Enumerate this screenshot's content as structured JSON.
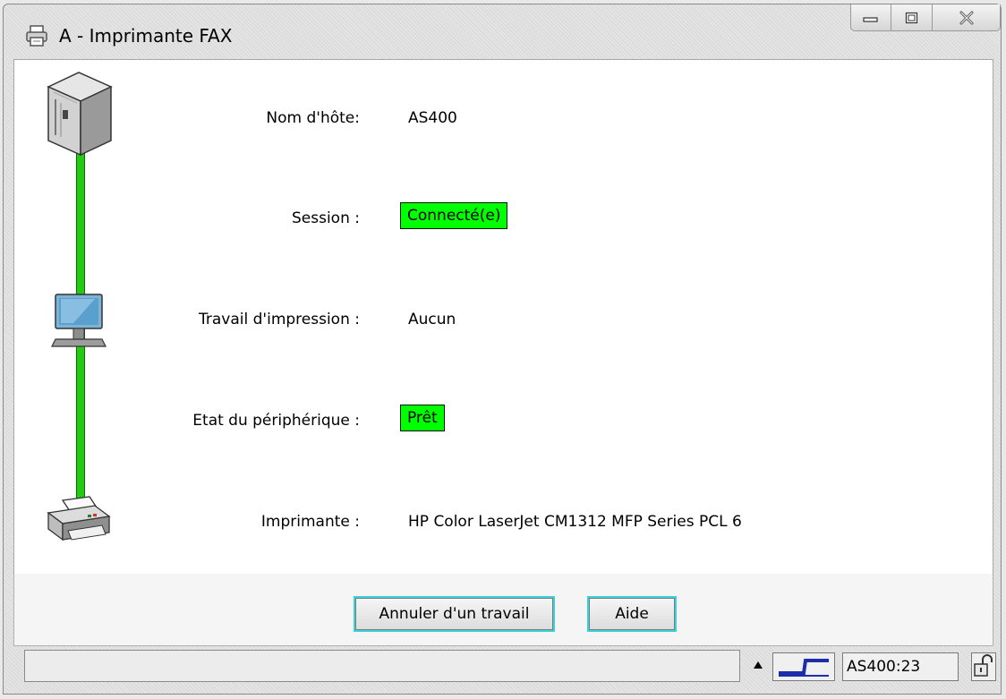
{
  "window": {
    "title": "A - Imprimante FAX",
    "title_icon": "printer-icon",
    "controls": [
      "minimize-icon",
      "maximize-icon",
      "close-icon"
    ]
  },
  "rows": {
    "host": {
      "label": "Nom d'hôte:",
      "value": "AS400"
    },
    "session": {
      "label": "Session :",
      "value": "Connecté(e)"
    },
    "job": {
      "label": "Travail d'impression :",
      "value": "Aucun"
    },
    "device": {
      "label": "Etat du périphérique :",
      "value": "Prêt"
    },
    "printer": {
      "label": "Imprimante :",
      "value": "HP Color LaserJet CM1312 MFP Series PCL 6"
    }
  },
  "chain_icons": [
    "server-icon",
    "monitor-icon",
    "printer-device-icon"
  ],
  "buttons": {
    "cancel_job": "Annuler d'un travail",
    "help": "Aide"
  },
  "statusbar": {
    "message": "",
    "host_port": "AS400:23",
    "connection_icon": "connection-icon",
    "lock_icon": "lock-icon"
  },
  "colors": {
    "status_ok": "#00ff00",
    "connector_line": "#22cc11",
    "button_focus_border": "#37d3d8"
  }
}
